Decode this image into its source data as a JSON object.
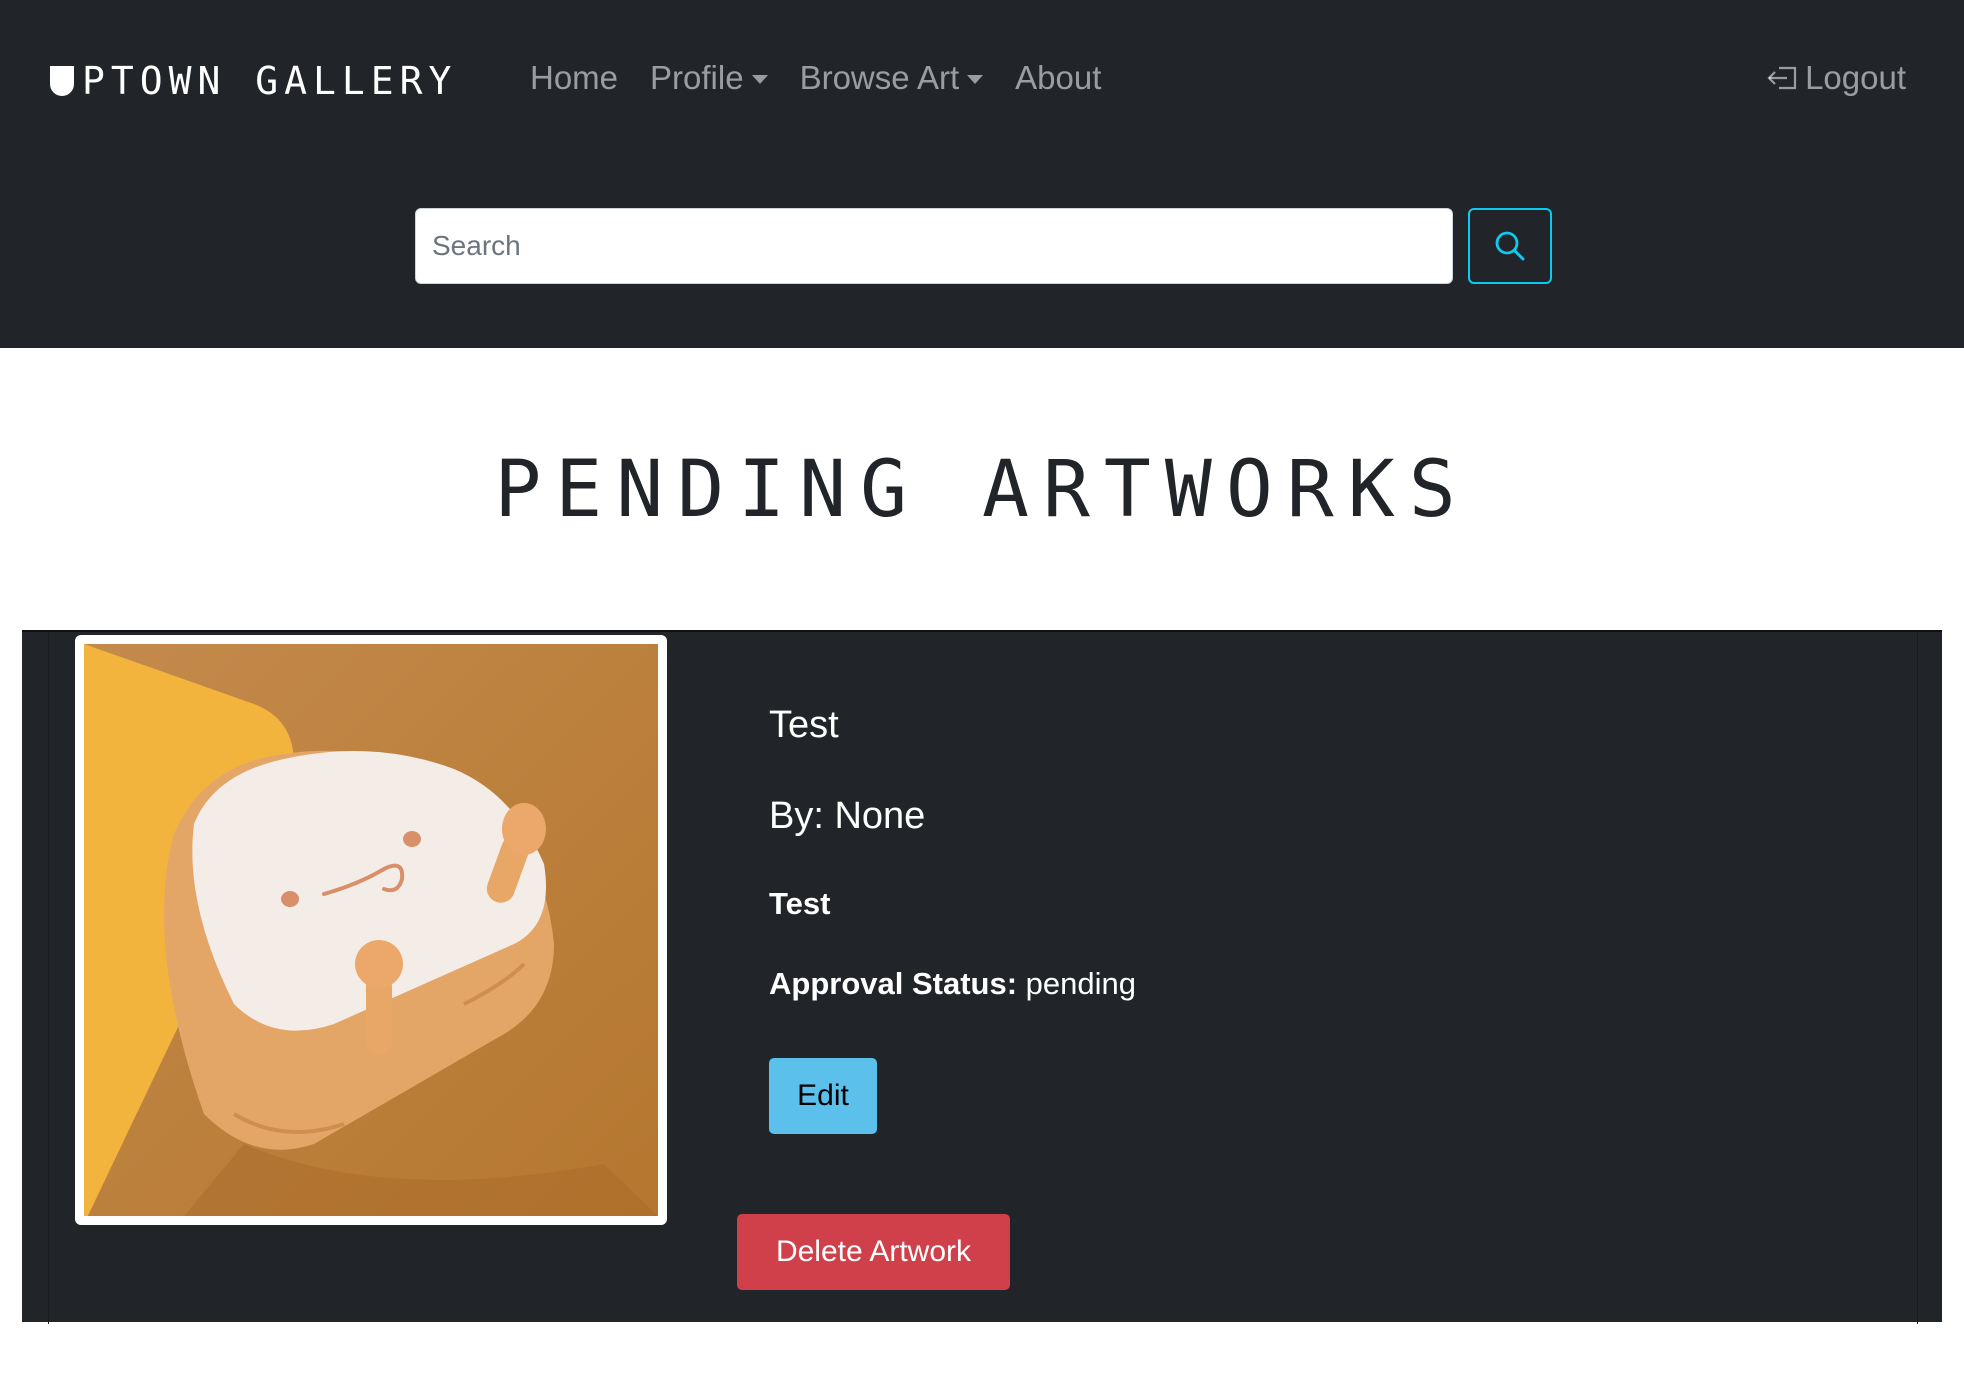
{
  "navbar": {
    "brand": "UPTOWN GALLERY",
    "brand_rest": "PTOWN GALLERY",
    "links": [
      {
        "label": "Home"
      },
      {
        "label": "Profile"
      },
      {
        "label": "Browse Art"
      },
      {
        "label": "About"
      }
    ],
    "logout_label": "Logout",
    "logout_icon": "logout-icon",
    "search_placeholder": "Search",
    "search_icon": "search-icon"
  },
  "page": {
    "title": "PENDING ARTWORKS"
  },
  "artwork": {
    "title": "Test",
    "artist": "By: None",
    "description": "Test",
    "status_label": "Approval Status:",
    "status_value": "pending",
    "edit_label": "Edit",
    "delete_label": "Delete Artwork"
  },
  "colors": {
    "navbar_bg": "#212529",
    "accent_cyan": "#0dcaf0",
    "edit_button": "#5bc0eb",
    "delete_button": "#d0404a"
  }
}
